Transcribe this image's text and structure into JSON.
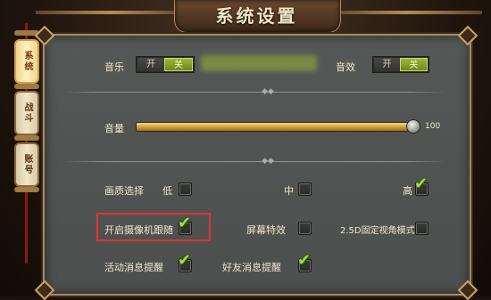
{
  "title": "系统设置",
  "tabs": [
    {
      "label": "系统",
      "active": true
    },
    {
      "label": "战斗",
      "active": false
    },
    {
      "label": "账号",
      "active": false
    }
  ],
  "music": {
    "label": "音乐",
    "on_label": "开",
    "off_label": "关",
    "value": "关"
  },
  "sound": {
    "label": "音效",
    "on_label": "开",
    "off_label": "关",
    "value": "关"
  },
  "volume": {
    "label": "音量",
    "value": "100",
    "fraction": 1.0
  },
  "quality": {
    "label": "画质选择",
    "options": [
      {
        "label": "低",
        "checked": false
      },
      {
        "label": "中",
        "checked": false
      },
      {
        "label": "高",
        "checked": true
      }
    ]
  },
  "options": {
    "camera_follow": {
      "label": "开启摄像机跟随",
      "checked": true
    },
    "screen_effects": {
      "label": "屏幕特效",
      "checked": false
    },
    "fixed_view": {
      "label": "2.5D固定视角模式",
      "checked": false
    },
    "activity_reminder": {
      "label": "活动消息提醒",
      "checked": true
    },
    "friend_reminder": {
      "label": "好友消息提醒",
      "checked": true
    }
  },
  "colors": {
    "accent_green": "#9fe13a",
    "toggle_on": "#8aa52c",
    "highlight": "#e03434"
  }
}
